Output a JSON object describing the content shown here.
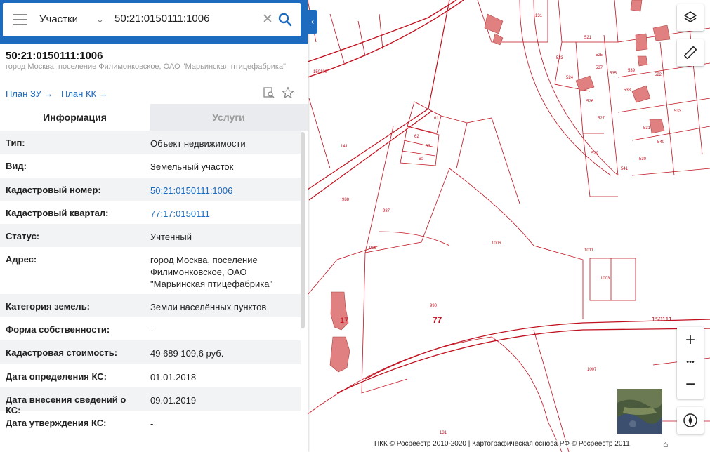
{
  "search": {
    "select_label": "Участки",
    "query": "50:21:0150111:1006"
  },
  "object": {
    "title": "50:21:0150111:1006",
    "address": "город Москва, поселение Филимонковское, ОАО \"Марьинская птицефабрика\""
  },
  "links": {
    "plan_zu": "План ЗУ",
    "plan_kk": "План КК"
  },
  "tabs": {
    "info": "Информация",
    "services": "Услуги"
  },
  "attributes": [
    {
      "key": "Тип:",
      "value": "Объект недвижимости"
    },
    {
      "key": "Вид:",
      "value": "Земельный участок"
    },
    {
      "key": "Кадастровый номер:",
      "value": "50:21:0150111:1006"
    },
    {
      "key": "Кадастровый квартал:",
      "value": "77:17:0150111"
    },
    {
      "key": "Статус:",
      "value": "Учтенный"
    },
    {
      "key": "Адрес:",
      "value": "город Москва, поселение Филимонковское, ОАО \"Марьинская птицефабрика\""
    },
    {
      "key": "Категория земель:",
      "value": "Земли населённых пунктов"
    },
    {
      "key": "Форма собственности:",
      "value": "-"
    },
    {
      "key": "Кадастровая стоимость:",
      "value": "49 689 109,6 руб."
    },
    {
      "key": "Дата определения КС:",
      "value": "01.01.2018"
    },
    {
      "key": "Дата внесения сведений о КС:",
      "value": "09.01.2019"
    },
    {
      "key": "Дата утверждения КС:",
      "value": "-"
    }
  ],
  "map": {
    "labels": [
      "77",
      "17",
      "150111",
      "1006",
      "990",
      "987",
      "986",
      "988",
      "1007",
      "1011",
      "1003",
      "521",
      "522",
      "523",
      "524",
      "525",
      "526",
      "527",
      "529",
      "530",
      "531",
      "533",
      "535",
      "537",
      "538",
      "539",
      "540",
      "541",
      "60",
      "61",
      "62",
      "63",
      "150100",
      "141",
      "131",
      "131"
    ],
    "zoom_in": "+",
    "zoom_more": "•••",
    "zoom_out": "−",
    "attribution": "ПКК © Росреестр 2010-2020 | Картографическая основа РФ © Росреестр 2011"
  },
  "colors": {
    "accent": "#1d6bbf",
    "parcel_line": "#c0111f",
    "building": "#e08080"
  }
}
